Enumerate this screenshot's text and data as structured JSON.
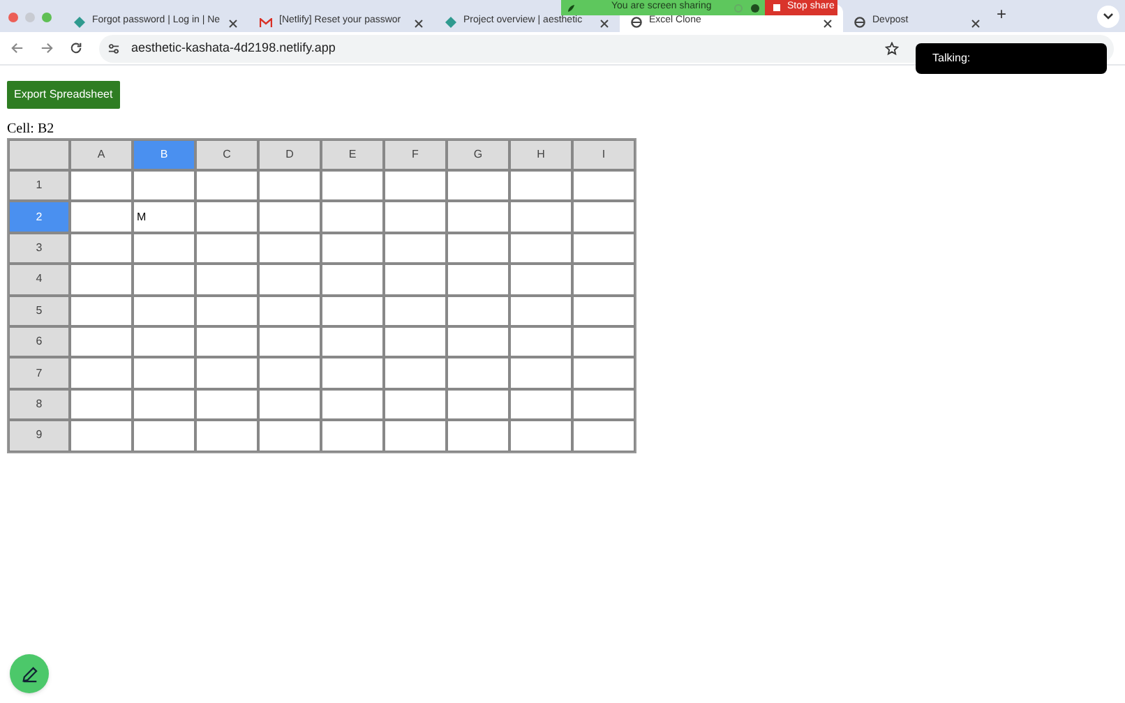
{
  "browser": {
    "tabs": [
      {
        "title": "Forgot password | Log in | Ne",
        "kind": "diamond",
        "selected": false
      },
      {
        "title": "[Netlify] Reset your passwor",
        "kind": "mail",
        "selected": false
      },
      {
        "title": "Project overview | aesthetic",
        "kind": "diamond",
        "selected": false
      },
      {
        "title": "Excel Clone",
        "kind": "globe",
        "selected": true
      },
      {
        "title": "Devpost",
        "kind": "globe",
        "selected": false
      }
    ],
    "new_tab": "+",
    "url": "aesthetic-kashata-4d2198.netlify.app"
  },
  "share_banner": {
    "message": "You are screen sharing",
    "stop_label": "Stop share"
  },
  "talking_overlay": {
    "label": "Talking:"
  },
  "export_button": "Export Spreadsheet",
  "cell_label": "Cell: B2",
  "sheet": {
    "columns": [
      {
        "label": "A",
        "selected": false
      },
      {
        "label": "B",
        "selected": true
      },
      {
        "label": "C",
        "selected": false
      },
      {
        "label": "D",
        "selected": false
      },
      {
        "label": "E",
        "selected": false
      },
      {
        "label": "F",
        "selected": false
      },
      {
        "label": "G",
        "selected": false
      },
      {
        "label": "H",
        "selected": false
      },
      {
        "label": "I",
        "selected": false
      }
    ],
    "rows": [
      {
        "label": "1",
        "selected": false,
        "cells": [
          null,
          null,
          null,
          null,
          null,
          null,
          null,
          null,
          null
        ]
      },
      {
        "label": "2",
        "selected": true,
        "cells": [
          null,
          "M",
          null,
          null,
          null,
          null,
          null,
          null,
          null
        ]
      },
      {
        "label": "3",
        "selected": false,
        "cells": [
          null,
          null,
          null,
          null,
          null,
          null,
          null,
          null,
          null
        ]
      },
      {
        "label": "4",
        "selected": false,
        "cells": [
          null,
          null,
          null,
          null,
          null,
          null,
          null,
          null,
          null
        ]
      },
      {
        "label": "5",
        "selected": false,
        "cells": [
          null,
          null,
          null,
          null,
          null,
          null,
          null,
          null,
          null
        ]
      },
      {
        "label": "6",
        "selected": false,
        "cells": [
          null,
          null,
          null,
          null,
          null,
          null,
          null,
          null,
          null
        ]
      },
      {
        "label": "7",
        "selected": false,
        "cells": [
          null,
          null,
          null,
          null,
          null,
          null,
          null,
          null,
          null
        ]
      },
      {
        "label": "8",
        "selected": false,
        "cells": [
          null,
          null,
          null,
          null,
          null,
          null,
          null,
          null,
          null
        ]
      },
      {
        "label": "9",
        "selected": false,
        "cells": [
          null,
          null,
          null,
          null,
          null,
          null,
          null,
          null,
          null
        ]
      }
    ]
  }
}
